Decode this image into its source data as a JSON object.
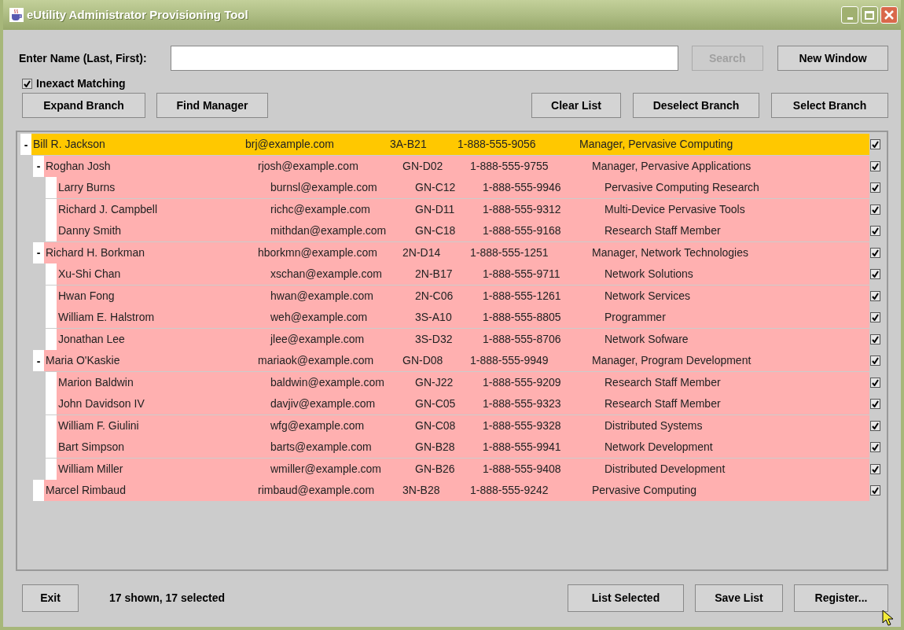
{
  "window": {
    "title": "eUtility Administrator Provisioning Tool"
  },
  "search": {
    "label": "Enter Name (Last, First):",
    "search_button": {
      "label": "Search",
      "disabled": true
    },
    "new_window_button": "New Window"
  },
  "inexact_matching": {
    "label": "Inexact Matching",
    "checked": true
  },
  "left_buttons": [
    "Expand Branch",
    "Find Manager"
  ],
  "right_buttons": [
    "Clear List",
    "Deselect Branch",
    "Select Branch"
  ],
  "tree": [
    {
      "toggle": "-",
      "name": "Bill R. Jackson",
      "email": "brj@example.com",
      "room": "3A-B21",
      "phone": "1-888-555-9056",
      "title": "Manager, Pervasive Computing",
      "selected": true,
      "checked": true,
      "children": [
        {
          "toggle": "-",
          "name": "Roghan Josh",
          "email": "rjosh@example.com",
          "room": "GN-D02",
          "phone": "1-888-555-9755",
          "title": "Manager, Pervasive Applications",
          "selected": false,
          "checked": true,
          "children": [
            {
              "name": "Larry Burns",
              "email": "burnsl@example.com",
              "room": "GN-C12",
              "phone": "1-888-555-9946",
              "title": "Pervasive Computing Research",
              "selected": false,
              "checked": true
            },
            {
              "name": "Richard J. Campbell",
              "email": "richc@example.com",
              "room": "GN-D11",
              "phone": "1-888-555-9312",
              "title": "Multi-Device Pervasive Tools",
              "selected": false,
              "checked": true
            },
            {
              "name": "Danny Smith",
              "email": "mithdan@example.com",
              "room": "GN-C18",
              "phone": "1-888-555-9168",
              "title": "Research Staff Member",
              "selected": false,
              "checked": true
            }
          ]
        },
        {
          "toggle": "-",
          "name": "Richard H. Borkman",
          "email": "hborkmn@example.com",
          "room": "2N-D14",
          "phone": "1-888-555-1251",
          "title": "Manager, Network Technologies",
          "selected": false,
          "checked": true,
          "children": [
            {
              "name": "Xu-Shi Chan",
              "email": "xschan@example.com",
              "room": "2N-B17",
              "phone": "1-888-555-9711",
              "title": "Network Solutions",
              "selected": false,
              "checked": true
            },
            {
              "name": "Hwan Fong",
              "email": "hwan@example.com",
              "room": "2N-C06",
              "phone": "1-888-555-1261",
              "title": "Network Services",
              "selected": false,
              "checked": true
            },
            {
              "name": "William E. Halstrom",
              "email": "weh@example.com",
              "room": "3S-A10",
              "phone": "1-888-555-8805",
              "title": "Programmer",
              "selected": false,
              "checked": true
            },
            {
              "name": "Jonathan Lee",
              "email": "jlee@example.com",
              "room": "3S-D32",
              "phone": "1-888-555-8706",
              "title": "Network Sofware",
              "selected": false,
              "checked": true
            }
          ]
        },
        {
          "toggle": "-",
          "name": "Maria O'Kaskie",
          "email": "mariaok@example.com",
          "room": "GN-D08",
          "phone": "1-888-555-9949",
          "title": "Manager, Program Development",
          "selected": false,
          "checked": true,
          "children": [
            {
              "name": "Marion Baldwin",
              "email": "baldwin@example.com",
              "room": "GN-J22",
              "phone": "1-888-555-9209",
              "title": "Research Staff Member",
              "selected": false,
              "checked": true
            },
            {
              "name": "John Davidson IV",
              "email": "davjiv@example.com",
              "room": "GN-C05",
              "phone": "1-888-555-9323",
              "title": "Research Staff Member",
              "selected": false,
              "checked": true
            },
            {
              "name": "William F. Giulini",
              "email": "wfg@example.com",
              "room": "GN-C08",
              "phone": "1-888-555-9328",
              "title": "Distributed Systems",
              "selected": false,
              "checked": true
            },
            {
              "name": "Bart Simpson",
              "email": "barts@example.com",
              "room": "GN-B28",
              "phone": "1-888-555-9941",
              "title": "Network Development",
              "selected": false,
              "checked": true
            },
            {
              "name": "William Miller",
              "email": "wmiller@example.com",
              "room": "GN-B26",
              "phone": "1-888-555-9408",
              "title": "Distributed Development",
              "selected": false,
              "checked": true
            }
          ]
        },
        {
          "name": "Marcel Rimbaud",
          "email": "rimbaud@example.com",
          "room": "3N-B28",
          "phone": "1-888-555-9242",
          "title": "Pervasive Computing",
          "selected": false,
          "checked": true
        }
      ]
    }
  ],
  "footer": {
    "exit_button": "Exit",
    "status": "17 shown, 17 selected",
    "buttons": [
      "List Selected",
      "Save List",
      "Register..."
    ]
  }
}
